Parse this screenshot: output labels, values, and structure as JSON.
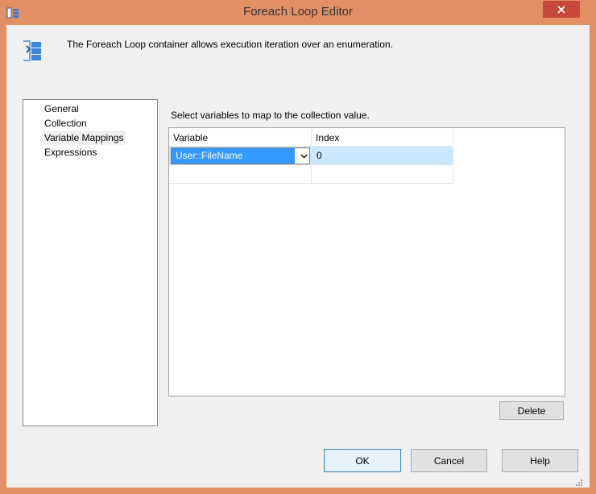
{
  "window": {
    "title": "Foreach Loop Editor"
  },
  "header": {
    "description": "The Foreach Loop container allows execution iteration over an enumeration."
  },
  "nav": {
    "items": [
      {
        "label": "General"
      },
      {
        "label": "Collection"
      },
      {
        "label": "Variable Mappings",
        "selected": true
      },
      {
        "label": "Expressions"
      }
    ]
  },
  "main": {
    "instruction": "Select variables to map to the collection value.",
    "columns": [
      "Variable",
      "Index"
    ],
    "rows": [
      {
        "variable": "User::FileName",
        "index": "0"
      }
    ],
    "delete_label": "Delete"
  },
  "footer": {
    "ok_label": "OK",
    "cancel_label": "Cancel",
    "help_label": "Help"
  },
  "colors": {
    "frame": "#e28f66",
    "close_button": "#c7493b",
    "selection": "#3399ff",
    "row_highlight": "#cce8ff"
  }
}
